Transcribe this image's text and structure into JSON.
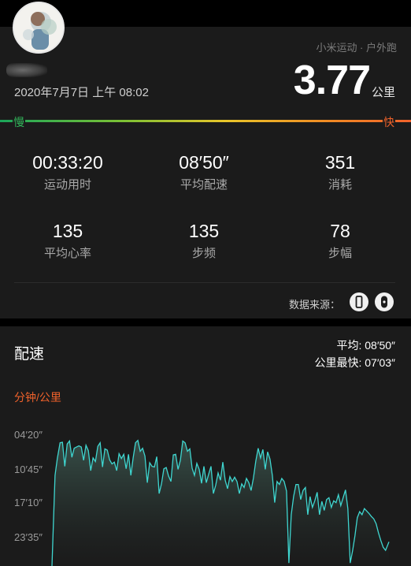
{
  "record": {
    "source": "小米运动 · 户外跑",
    "datetime": "2020年7月7日 上午 08:02",
    "distance": "3.77",
    "distance_unit": "公里"
  },
  "pace_bar": {
    "slow_label": "慢",
    "fast_label": "快"
  },
  "stats": [
    {
      "value": "00:33:20",
      "label": "运动用时"
    },
    {
      "value": "08′50″",
      "label": "平均配速"
    },
    {
      "value": "351",
      "label": "消耗"
    },
    {
      "value": "135",
      "label": "平均心率"
    },
    {
      "value": "135",
      "label": "步频"
    },
    {
      "value": "78",
      "label": "步幅"
    }
  ],
  "data_source": {
    "label": "数据来源：",
    "devices": [
      "phone-icon",
      "mi-band-icon"
    ]
  },
  "pace_section": {
    "title": "配速",
    "avg": "平均: 08′50″",
    "fastest": "公里最快: 07′03″",
    "unit": "分钟/公里"
  },
  "chart_data": {
    "type": "area",
    "y_reversed": true,
    "ylabel": "分钟/公里",
    "yticks": [
      "04′20″",
      "10′45″",
      "17′10″",
      "23′35″"
    ],
    "ylim": [
      4.33,
      26.0
    ],
    "line_color": "#3fd6d0",
    "x": [
      0.0,
      0.009,
      0.016,
      0.024,
      0.031,
      0.038,
      0.045,
      0.052,
      0.059,
      0.066,
      0.073,
      0.08,
      0.087,
      0.094,
      0.101,
      0.108,
      0.115,
      0.122,
      0.129,
      0.136,
      0.143,
      0.15,
      0.157,
      0.164,
      0.171,
      0.178,
      0.185,
      0.192,
      0.199,
      0.206,
      0.213,
      0.22,
      0.227,
      0.234,
      0.241,
      0.248,
      0.255,
      0.262,
      0.269,
      0.276,
      0.283,
      0.29,
      0.297,
      0.304,
      0.311,
      0.318,
      0.325,
      0.332,
      0.339,
      0.346,
      0.353,
      0.36,
      0.367,
      0.374,
      0.381,
      0.388,
      0.395,
      0.402,
      0.409,
      0.416,
      0.423,
      0.43,
      0.437,
      0.444,
      0.451,
      0.458,
      0.465,
      0.472,
      0.479,
      0.486,
      0.493,
      0.5,
      0.507,
      0.514,
      0.521,
      0.528,
      0.535,
      0.542,
      0.549,
      0.556,
      0.563,
      0.57,
      0.577,
      0.584,
      0.591,
      0.598,
      0.605,
      0.612,
      0.619,
      0.626,
      0.633,
      0.64,
      0.647,
      0.654,
      0.661,
      0.668,
      0.675,
      0.682,
      0.689,
      0.696,
      0.703,
      0.71,
      0.717,
      0.724,
      0.731,
      0.738,
      0.745,
      0.752,
      0.759,
      0.766,
      0.773,
      0.78,
      0.787,
      0.794,
      0.801,
      0.808,
      0.815,
      0.822,
      0.829,
      0.836,
      0.843,
      0.85,
      0.857,
      0.864,
      0.871,
      0.878,
      0.885,
      0.892,
      0.899,
      0.906,
      0.913,
      0.92,
      0.927,
      0.934,
      0.941,
      0.948,
      0.955,
      0.962,
      0.969,
      0.976,
      0.983,
      0.99,
      1.0
    ],
    "values": [
      26.0,
      11.0,
      8.2,
      5.6,
      5.5,
      9.5,
      5.8,
      5.3,
      8.0,
      6.5,
      6.3,
      6.1,
      6.3,
      8.5,
      6.0,
      6.9,
      10.2,
      8.1,
      8.7,
      6.2,
      5.6,
      9.6,
      6.6,
      6.8,
      8.4,
      9.1,
      8.8,
      10.2,
      7.4,
      8.2,
      7.5,
      9.9,
      7.5,
      11.0,
      8.1,
      5.6,
      5.2,
      7.0,
      6.5,
      7.8,
      12.2,
      8.9,
      9.5,
      9.6,
      7.9,
      14.0,
      12.4,
      9.9,
      9.7,
      11.1,
      12.0,
      7.6,
      7.5,
      10.0,
      8.5,
      5.3,
      5.6,
      7.0,
      6.6,
      9.8,
      11.0,
      9.0,
      10.0,
      12.3,
      9.5,
      12.2,
      10.8,
      9.5,
      14.0,
      12.6,
      10.6,
      11.8,
      8.8,
      11.8,
      13.2,
      11.2,
      12.0,
      11.3,
      12.0,
      14.0,
      12.4,
      13.0,
      11.5,
      12.2,
      13.5,
      11.4,
      8.6,
      6.5,
      8.1,
      6.7,
      10.0,
      7.1,
      8.3,
      11.0,
      15.5,
      12.0,
      12.5,
      11.5,
      12.0,
      13.6,
      25.5,
      17.5,
      14.5,
      12.5,
      12.5,
      15.0,
      13.5,
      13.0,
      17.5,
      14.5,
      16.3,
      15.2,
      13.8,
      17.5,
      15.3,
      16.8,
      15.0,
      14.7,
      16.3,
      15.2,
      15.5,
      14.2,
      16.0,
      14.7,
      13.4,
      16.5,
      25.5,
      23.5,
      21.0,
      18.0,
      17.0,
      17.5,
      16.5,
      16.9,
      17.3,
      17.8,
      18.2,
      19.0,
      20.5,
      21.8,
      22.9,
      23.4,
      22.0
    ]
  }
}
